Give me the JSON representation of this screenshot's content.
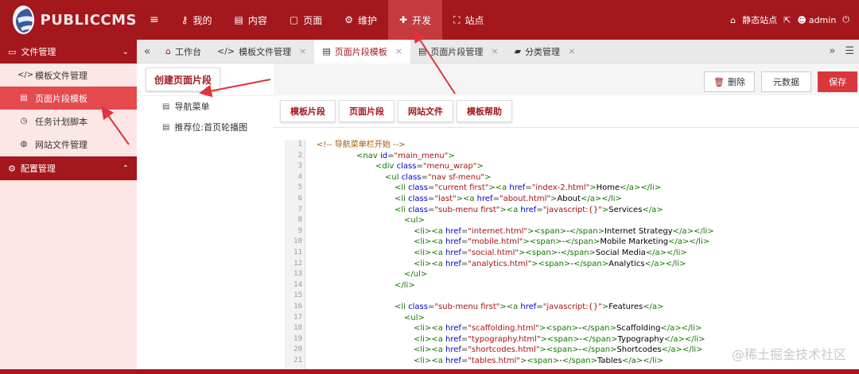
{
  "brand": {
    "logo_text": "PUBLICCMS"
  },
  "topnav": {
    "items": [
      {
        "icon": "key-icon",
        "label": "我的"
      },
      {
        "icon": "file-icon",
        "label": "内容"
      },
      {
        "icon": "square-icon",
        "label": "页面"
      },
      {
        "icon": "cogs-icon",
        "label": "维护"
      },
      {
        "icon": "puzzle-icon",
        "label": "开发",
        "active": true
      },
      {
        "icon": "sitemap-icon",
        "label": "站点"
      }
    ],
    "right": {
      "static_site": "静态站点",
      "user": "admin"
    }
  },
  "sidebar": {
    "section1": {
      "label": "文件管理"
    },
    "items": [
      {
        "label": "模板文件管理"
      },
      {
        "label": "页面片段模板",
        "active": true
      },
      {
        "label": "任务计划脚本"
      },
      {
        "label": "网站文件管理"
      }
    ],
    "section2": {
      "label": "配置管理"
    }
  },
  "tabs": [
    {
      "label": "工作台"
    },
    {
      "label": "模板文件管理"
    },
    {
      "label": "页面片段模板",
      "active": true
    },
    {
      "label": "页面片段管理"
    },
    {
      "label": "分类管理"
    }
  ],
  "left_pane": {
    "create_button": "创建页面片段",
    "tree": [
      "导航菜单",
      "推荐位:首页轮播图"
    ]
  },
  "toolbar": {
    "delete": "删除",
    "metadata": "元数据",
    "save": "保存"
  },
  "sub_tabs": [
    "模板片段",
    "页面片段",
    "网站文件",
    "模板帮助"
  ],
  "watermark": "@稀土掘金技术社区",
  "colors": {
    "brand_red": "#a4171d",
    "active_red": "#e54a4f",
    "save_red": "#d9373c",
    "sidebar_bg": "#fde6e6"
  }
}
